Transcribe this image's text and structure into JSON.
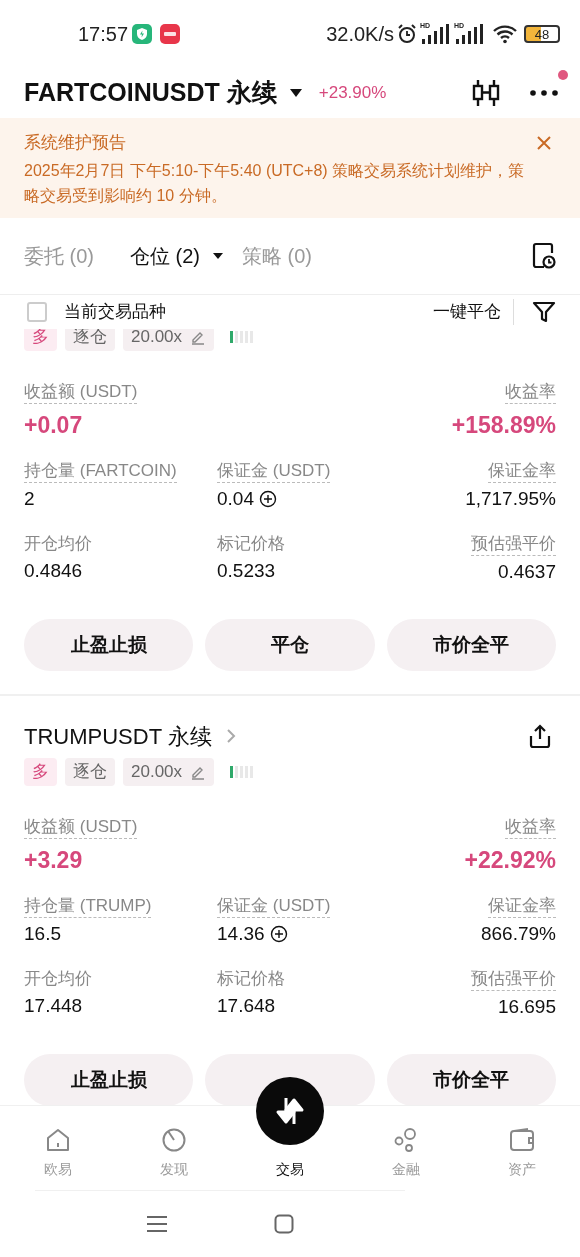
{
  "status_bar": {
    "time": "17:57",
    "speed": "32.0K/s",
    "signals": [
      {
        "label": "HD"
      },
      {
        "label": "HD"
      }
    ],
    "battery": "48"
  },
  "header": {
    "title": "FARTCOINUSDT 永续",
    "change": "+23.90%",
    "notification_dot": true
  },
  "notice": {
    "title": "系统维护预告",
    "body": "2025年2月7日 下午5:10-下午5:40 (UTC+8) 策略交易系统计划维护，策略交易受到影响约 10 分钟。"
  },
  "tabs": [
    {
      "label": "委托 (0)",
      "selected": false
    },
    {
      "label": "仓位 (2)",
      "selected": true,
      "dropdown": true
    },
    {
      "label": "策略 (0)",
      "selected": false
    }
  ],
  "filter": {
    "label": "当前交易品种",
    "checked": false,
    "close_all": "一键平仓"
  },
  "positions": [
    {
      "tags": [
        {
          "kind": "side",
          "text": "多"
        },
        {
          "kind": "mode",
          "text": "逐仓"
        },
        {
          "kind": "leverage",
          "text": "20.00x"
        }
      ],
      "risk_meter": {
        "level": 0.2
      },
      "pnl_label": "收益额 (USDT)",
      "pnl": "+0.07",
      "rate_label": "收益率",
      "rate": "+158.89%",
      "fields": [
        {
          "label": "持仓量 (FARTCOIN)",
          "value": "2",
          "underline": true
        },
        {
          "label": "保证金 (USDT)",
          "value": "0.04",
          "underline": true,
          "add": true
        },
        {
          "label": "保证金率",
          "value": "1,717.95%",
          "underline": true
        },
        {
          "label": "开仓均价",
          "value": "0.4846",
          "underline": false
        },
        {
          "label": "标记价格",
          "value": "0.5233",
          "underline": false
        },
        {
          "label": "预估强平价",
          "value": "0.4637",
          "underline": true
        }
      ],
      "buttons": [
        {
          "label": "止盈止损"
        },
        {
          "label": "平仓"
        },
        {
          "label": "市价全平"
        }
      ]
    },
    {
      "title": "TRUMPUSDT 永续",
      "tags": [
        {
          "kind": "side",
          "text": "多"
        },
        {
          "kind": "mode",
          "text": "逐仓"
        },
        {
          "kind": "leverage",
          "text": "20.00x"
        }
      ],
      "risk_meter": {
        "level": 0.2
      },
      "pnl_label": "收益额 (USDT)",
      "pnl": "+3.29",
      "rate_label": "收益率",
      "rate": "+22.92%",
      "fields": [
        {
          "label": "持仓量 (TRUMP)",
          "value": "16.5",
          "underline": true
        },
        {
          "label": "保证金 (USDT)",
          "value": "14.36",
          "underline": true,
          "add": true
        },
        {
          "label": "保证金率",
          "value": "866.79%",
          "underline": true
        },
        {
          "label": "开仓均价",
          "value": "17.448",
          "underline": false
        },
        {
          "label": "标记价格",
          "value": "17.648",
          "underline": false
        },
        {
          "label": "预估强平价",
          "value": "16.695",
          "underline": true
        }
      ],
      "buttons": [
        {
          "label": "止盈止损"
        },
        {
          "covered": true
        },
        {
          "label": "市价全平"
        }
      ]
    }
  ],
  "bottom_nav": [
    {
      "label": "欧易",
      "kind": "home",
      "selected": false
    },
    {
      "label": "发现",
      "kind": "discover",
      "selected": false
    },
    {
      "label": "交易",
      "kind": "trade",
      "selected": true
    },
    {
      "label": "金融",
      "kind": "finance",
      "selected": false
    },
    {
      "label": "资产",
      "kind": "assets",
      "selected": false
    }
  ]
}
